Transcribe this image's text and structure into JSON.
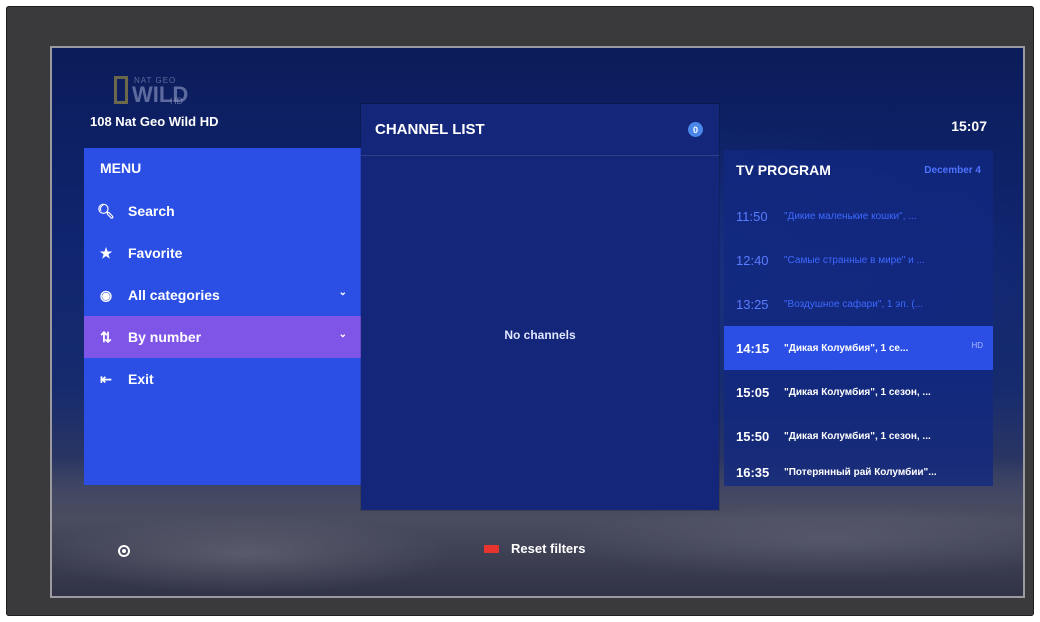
{
  "header": {
    "channel": "108  Nat Geo Wild HD",
    "clock": "15:07",
    "logo": {
      "small": "NAT GEO",
      "text": "WILD",
      "sub": "HD"
    }
  },
  "menu": {
    "title": "MENU",
    "items": [
      {
        "label": "Search",
        "icon": "search-icon",
        "glyph": "🔍︎"
      },
      {
        "label": "Favorite",
        "icon": "star-icon",
        "glyph": "★"
      },
      {
        "label": "All categories",
        "icon": "categories-icon",
        "glyph": "◉",
        "chevron": "⌄"
      },
      {
        "label": "By number",
        "icon": "sort-number-icon",
        "glyph": "⇅",
        "chevron": "⌄",
        "selected": true
      },
      {
        "label": "Exit",
        "icon": "exit-icon",
        "glyph": "⇤"
      }
    ]
  },
  "channel_list": {
    "title": "CHANNEL LIST",
    "count": "0",
    "empty_text": "No channels"
  },
  "tv_program": {
    "title": "TV PROGRAM",
    "date": "December 4",
    "rows": [
      {
        "time": "11:50",
        "title": "\"Дикие маленькие кошки\", ...",
        "state": "past"
      },
      {
        "time": "12:40",
        "title": "\"Самые странные в мире\" и ...",
        "state": "past"
      },
      {
        "time": "13:25",
        "title": "\"Воздушное сафари\", 1 эп. (...",
        "state": "past"
      },
      {
        "time": "14:15",
        "title": "\"Дикая Колумбия\", 1 се...",
        "state": "current",
        "badge": "HD"
      },
      {
        "time": "15:05",
        "title": "\"Дикая Колумбия\", 1 сезон, ...",
        "state": "future"
      },
      {
        "time": "15:50",
        "title": "\"Дикая Колумбия\", 1 сезон, ...",
        "state": "future"
      },
      {
        "time": "16:35",
        "title": "\"Потерянный рай Колумбии\"...",
        "state": "future"
      }
    ]
  },
  "footer": {
    "reset_label": "Reset filters",
    "reset_key_color": "#e8332f"
  },
  "colors": {
    "accent": "#2b4fe4",
    "selected": "#7f55e8",
    "panel": "#13267a"
  }
}
